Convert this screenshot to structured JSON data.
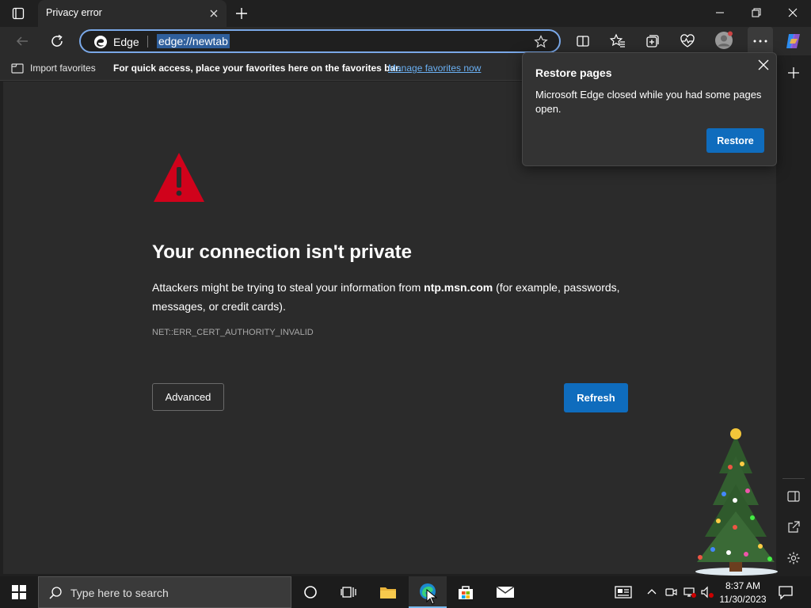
{
  "tab": {
    "title": "Privacy error"
  },
  "omnibox": {
    "site_label": "Edge",
    "url": "edge://newtab"
  },
  "favorites_bar": {
    "import_label": "Import favorites",
    "message": "For quick access, place your favorites here on the favorites bar.",
    "link": "Manage favorites now"
  },
  "error_page": {
    "title": "Your connection isn't private",
    "desc_before": "Attackers might be trying to steal your information from ",
    "desc_host": "ntp.msn.com",
    "desc_after": " (for example, passwords, messages, or credit cards).",
    "error_code": "NET::ERR_CERT_AUTHORITY_INVALID",
    "advanced_label": "Advanced",
    "refresh_label": "Refresh"
  },
  "popup": {
    "title": "Restore pages",
    "message": "Microsoft Edge closed while you had some pages open.",
    "restore_label": "Restore"
  },
  "taskbar": {
    "search_placeholder": "Type here to search",
    "time": "8:37 AM",
    "date": "11/30/2023"
  },
  "colors": {
    "accent": "#0f6cbd",
    "warning": "#d0021b",
    "link": "#6ab0f3"
  }
}
